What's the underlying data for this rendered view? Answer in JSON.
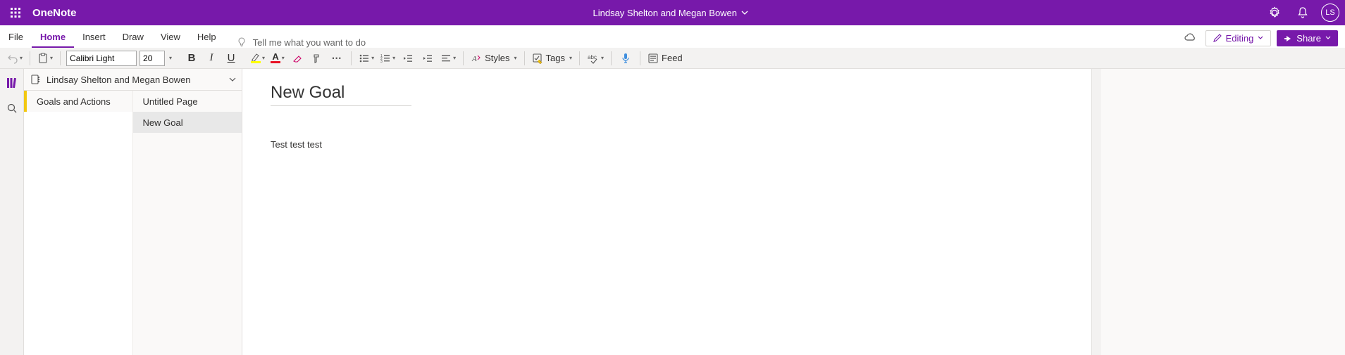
{
  "header": {
    "app_name": "OneNote",
    "notebook_title": "Lindsay Shelton and Megan Bowen",
    "avatar_initials": "LS"
  },
  "ribbon": {
    "tabs": [
      "File",
      "Home",
      "Insert",
      "Draw",
      "View",
      "Help"
    ],
    "active_tab": "Home",
    "tell_me_placeholder": "Tell me what you want to do",
    "editing_label": "Editing",
    "share_label": "Share"
  },
  "toolbar": {
    "font_name": "Calibri Light",
    "font_size": "20",
    "styles_label": "Styles",
    "tags_label": "Tags",
    "feed_label": "Feed"
  },
  "notebook": {
    "name": "Lindsay Shelton and Megan Bowen"
  },
  "sections": [
    {
      "name": "Goals and Actions",
      "selected": true
    }
  ],
  "pages": [
    {
      "title": "Untitled Page",
      "selected": false
    },
    {
      "title": "New Goal",
      "selected": true
    }
  ],
  "page": {
    "title": "New Goal",
    "body": "Test test test"
  }
}
